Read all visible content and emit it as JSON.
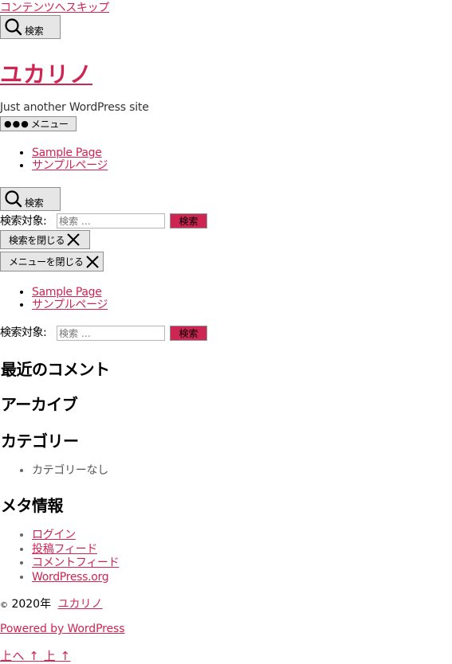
{
  "skip_link": "コンテンツへスキップ",
  "header": {
    "search_toggle_label": "検索",
    "site_title": "ユカリノ",
    "site_description": "Just another WordPress site",
    "menu_toggle_label": "メニュー",
    "nav_items": [
      "Sample Page",
      "サンプルページ"
    ]
  },
  "search_modal": {
    "toggle_label": "検索",
    "field_label": "検索対象:",
    "placeholder": "検索 …",
    "submit_label": "検索",
    "close_label": "検索を閉じる"
  },
  "menu_modal": {
    "close_label": "メニューを閉じる",
    "nav_items": [
      "Sample Page",
      "サンプルページ"
    ]
  },
  "footer_search": {
    "field_label": "検索対象:",
    "placeholder": "検索 …",
    "submit_label": "検索"
  },
  "widgets": {
    "recent_comments_title": "最近のコメント",
    "archives_title": "アーカイブ",
    "categories_title": "カテゴリー",
    "categories_items": [
      "カテゴリーなし"
    ],
    "meta_title": "メタ情報",
    "meta_items": [
      "ログイン",
      "投稿フィード",
      "コメントフィード",
      "WordPress.org"
    ]
  },
  "footer": {
    "copyright_symbol": "©",
    "copyright_year": "2020年",
    "site_link": "ユカリノ",
    "powered_by": "Powered by WordPress",
    "to_top_1": "上へ",
    "arrow_1": "↑",
    "to_top_2": "上",
    "arrow_2": "↑"
  }
}
